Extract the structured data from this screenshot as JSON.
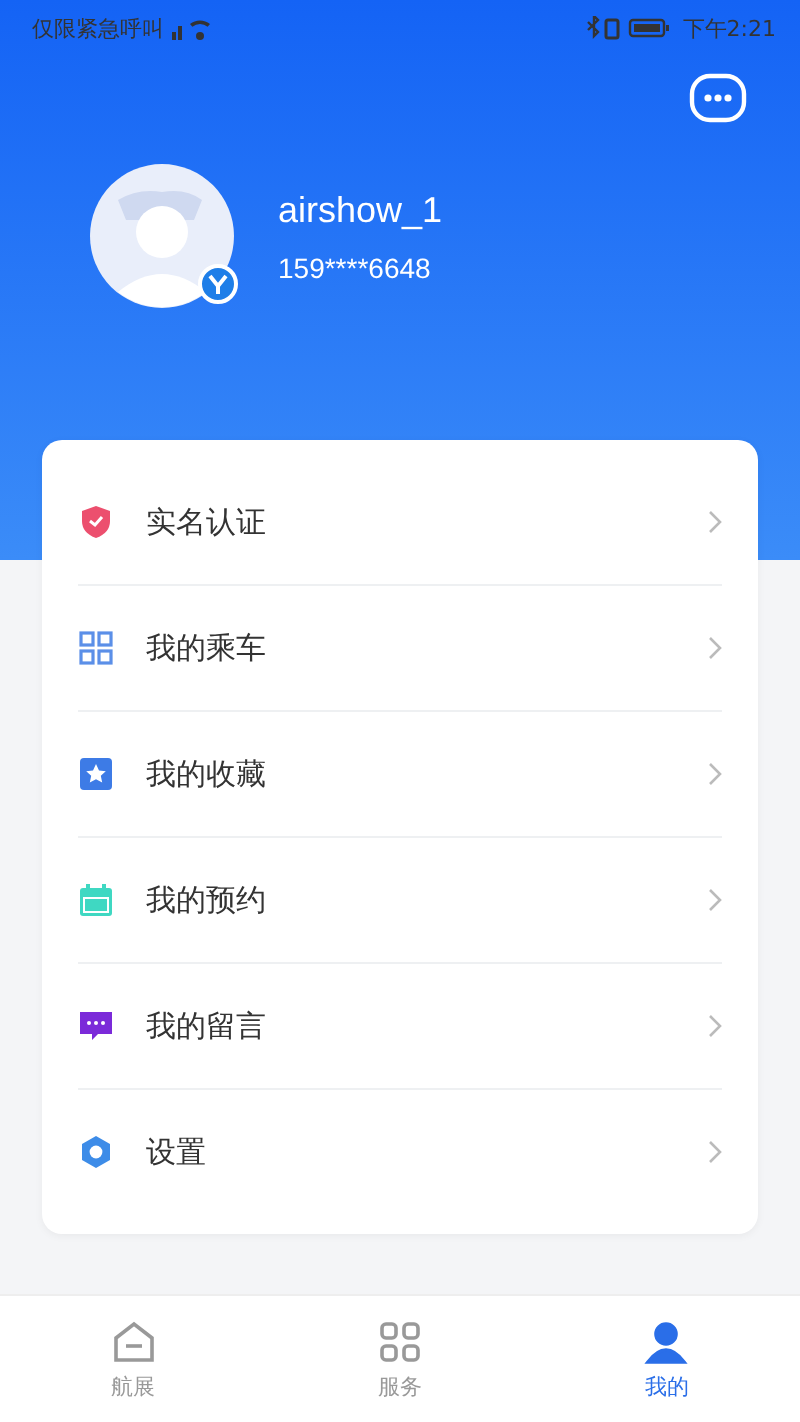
{
  "status_bar": {
    "carrier": "仅限紧急呼叫",
    "time": "下午2:21"
  },
  "profile": {
    "username": "airshow_1",
    "phone": "159****6648",
    "verified": true
  },
  "menu": [
    {
      "kind": "verify",
      "label": "实名认证"
    },
    {
      "kind": "ride",
      "label": "我的乘车"
    },
    {
      "kind": "favorite",
      "label": "我的收藏"
    },
    {
      "kind": "booking",
      "label": "我的预约"
    },
    {
      "kind": "message",
      "label": "我的留言"
    },
    {
      "kind": "settings",
      "label": "设置"
    }
  ],
  "tab_bar": [
    {
      "kind": "home",
      "label": "航展",
      "selected": false
    },
    {
      "kind": "service",
      "label": "服务",
      "selected": false
    },
    {
      "kind": "me",
      "label": "我的",
      "selected": true
    }
  ]
}
